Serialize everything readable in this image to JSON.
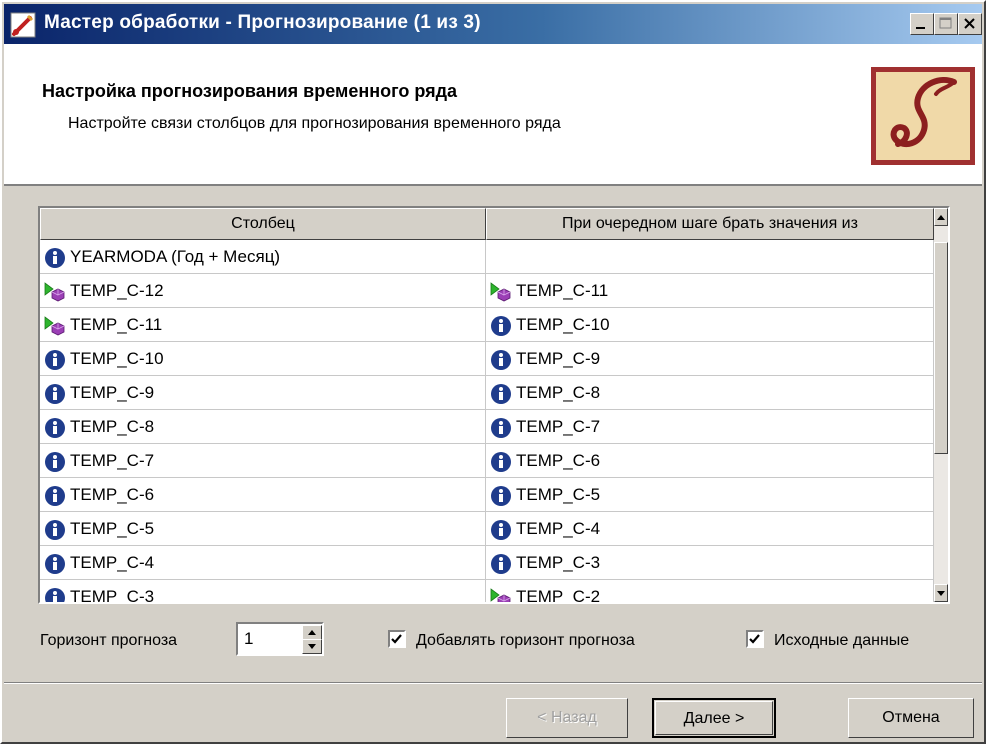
{
  "window": {
    "title": "Мастер обработки - Прогнозирование (1 из 3)"
  },
  "header": {
    "title": "Настройка прогнозирования временного ряда",
    "subtitle": "Настройте связи столбцов для прогнозирования временного ряда"
  },
  "grid": {
    "columns": [
      "Столбец",
      "При очередном шаге брать значения из"
    ],
    "rows": [
      {
        "col1": "YEARMODA (Год + Месяц)",
        "icon1": "info-icon",
        "col2": "",
        "icon2": ""
      },
      {
        "col1": "TEMP_C-12",
        "icon1": "forecast-icon",
        "col2": "TEMP_C-11",
        "icon2": "forecast-icon"
      },
      {
        "col1": "TEMP_C-11",
        "icon1": "forecast-icon",
        "col2": "TEMP_C-10",
        "icon2": "info-icon"
      },
      {
        "col1": "TEMP_C-10",
        "icon1": "info-icon",
        "col2": "TEMP_C-9",
        "icon2": "info-icon"
      },
      {
        "col1": "TEMP_C-9",
        "icon1": "info-icon",
        "col2": "TEMP_C-8",
        "icon2": "info-icon"
      },
      {
        "col1": "TEMP_C-8",
        "icon1": "info-icon",
        "col2": "TEMP_C-7",
        "icon2": "info-icon"
      },
      {
        "col1": "TEMP_C-7",
        "icon1": "info-icon",
        "col2": "TEMP_C-6",
        "icon2": "info-icon"
      },
      {
        "col1": "TEMP_C-6",
        "icon1": "info-icon",
        "col2": "TEMP_C-5",
        "icon2": "info-icon"
      },
      {
        "col1": "TEMP_C-5",
        "icon1": "info-icon",
        "col2": "TEMP_C-4",
        "icon2": "info-icon"
      },
      {
        "col1": "TEMP_C-4",
        "icon1": "info-icon",
        "col2": "TEMP_C-3",
        "icon2": "info-icon"
      },
      {
        "col1": "TEMP_C-3",
        "icon1": "info-icon",
        "col2": "TEMP_C-2",
        "icon2": "forecast-icon"
      }
    ]
  },
  "options": {
    "horizon_label": "Горизонт прогноза",
    "horizon_value": "1",
    "add_horizon_label": "Добавлять горизонт прогноза",
    "add_horizon_checked": true,
    "source_data_label": "Исходные данные",
    "source_data_checked": true
  },
  "buttons": {
    "back": "< Назад",
    "next": "Далее >",
    "cancel": "Отмена"
  },
  "colors": {
    "title_start": "#0a246a",
    "title_end": "#a6caf0",
    "face": "#d4d0c8",
    "info_icon": "#1f3c8c",
    "forecast_arrow": "#2db52d",
    "forecast_hex": "#9b3fb5",
    "logo_bg": "#f0d9a8",
    "logo_border": "#a03030"
  }
}
